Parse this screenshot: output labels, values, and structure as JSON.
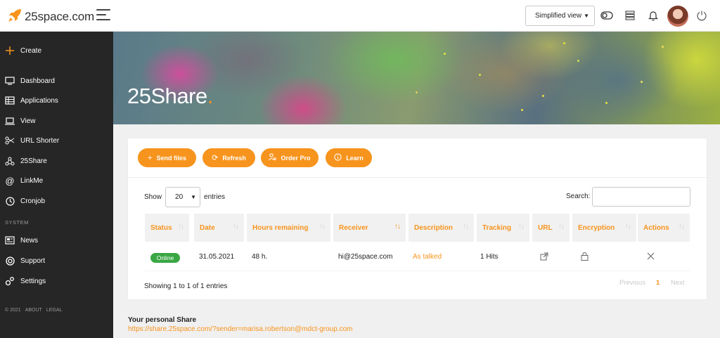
{
  "app": {
    "logo_text": "25space.com",
    "accent_color": "#f7941d"
  },
  "header": {
    "view_select_value": "Simplified view",
    "icons": [
      "toggle-icon",
      "server-icon",
      "bell-icon",
      "avatar",
      "power-icon"
    ]
  },
  "sidebar": {
    "create_label": "Create",
    "items": [
      {
        "label": "Dashboard",
        "icon": "monitor-icon"
      },
      {
        "label": "Applications",
        "icon": "grid-list-icon"
      },
      {
        "label": "View",
        "icon": "laptop-icon"
      },
      {
        "label": "URL Shorter",
        "icon": "scissors-icon"
      },
      {
        "label": "25Share",
        "icon": "share-icon"
      },
      {
        "label": "LinkMe",
        "icon": "at-icon"
      },
      {
        "label": "Cronjob",
        "icon": "clock-icon"
      }
    ],
    "system_label": "SYSTEM",
    "system_items": [
      {
        "label": "News",
        "icon": "newspaper-icon"
      },
      {
        "label": "Support",
        "icon": "lifebuoy-icon"
      },
      {
        "label": "Settings",
        "icon": "gears-icon"
      }
    ],
    "footer": {
      "copyright": "© 2021",
      "about": "ABOUT",
      "legal": "LEGAL"
    }
  },
  "hero": {
    "title": "25Share",
    "title_dot": "."
  },
  "toolbar": {
    "send_files": "Send files",
    "refresh": "Refresh",
    "order_pro": "Order Pro",
    "learn": "Learn"
  },
  "table": {
    "show_label": "Show",
    "entries_value": "20",
    "entries_label": "entries",
    "search_label": "Search:",
    "search_value": "",
    "columns": [
      "Status",
      "Date",
      "Hours remaining",
      "Receiver",
      "Description",
      "Tracking",
      "URL",
      "Encryption",
      "Actions"
    ],
    "rows": [
      {
        "status": "Online",
        "date": "31.05.2021",
        "hours": "48 h.",
        "receiver": "hi@25space.com",
        "description": "As talked",
        "tracking": "1 Hits"
      }
    ],
    "info": "Showing 1 to 1 of 1 entries",
    "pagination": {
      "previous": "Previous",
      "current": "1",
      "next": "Next"
    }
  },
  "personal": {
    "title": "Your personal Share",
    "url": "https://share.25space.com/?sender=marisa.robertson@mdct-group.com"
  }
}
